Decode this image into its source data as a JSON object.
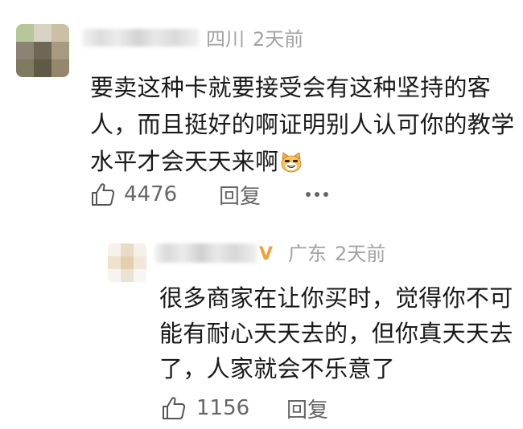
{
  "comment": {
    "location": "四川",
    "time": "2天前",
    "text_lines": [
      "要卖这种卡就要接受会有这种坚持的客",
      "人，而且挺好的啊证明别人认可你的教学",
      "水平才会天天来啊"
    ],
    "emoji_icon": "grinning-cat-face-icon",
    "like_count": "4476",
    "reply_label": "回复",
    "more_icon": "more-dots-icon"
  },
  "reply": {
    "badge": "V",
    "location": "广东",
    "time": "2天前",
    "text_lines": [
      "很多商家在让你买时，觉得你不可",
      "能有耐心天天去的，但你真天天去",
      "了，人家就会不乐意了"
    ],
    "like_count": "1156",
    "reply_label": "回复"
  },
  "colors": {
    "meta_gray": "#a3a3a3",
    "action_gray": "#666666",
    "text": "#1a1a1a",
    "vip_orange": "#f0a23a"
  }
}
